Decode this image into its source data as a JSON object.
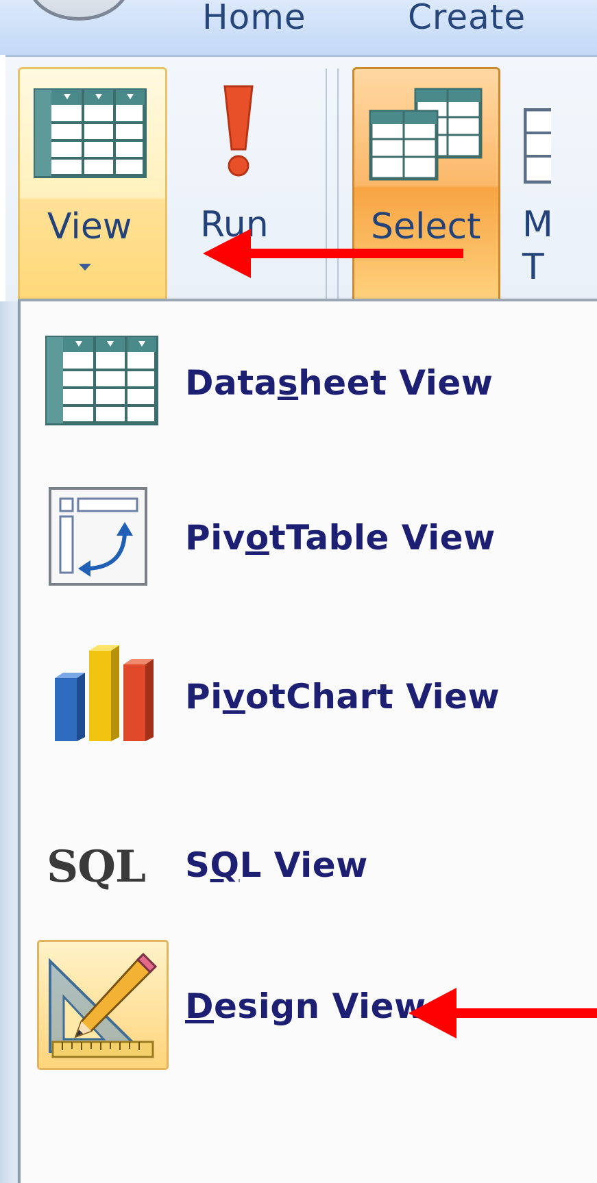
{
  "tabs": [
    {
      "label": "Home"
    },
    {
      "label": "Create"
    }
  ],
  "ribbon": {
    "view_button": {
      "label": "View",
      "icon": "datasheet-icon"
    },
    "run_button": {
      "label": "Run",
      "icon": "exclamation-icon"
    },
    "select_button": {
      "label": "Select",
      "icon": "select-query-icon"
    },
    "partial_button": {
      "label_line1": "M",
      "label_line2": "T"
    }
  },
  "menu": {
    "items": [
      {
        "pre": "Data",
        "key": "s",
        "post": "heet View",
        "icon": "datasheet-icon"
      },
      {
        "pre": "Piv",
        "key": "o",
        "post": "tTable View",
        "icon": "pivottable-icon"
      },
      {
        "pre": "Pi",
        "key": "v",
        "post": "otChart View",
        "icon": "pivotchart-icon"
      },
      {
        "pre": "S",
        "key": "Q",
        "post": "L View",
        "icon": "sql-icon",
        "icon_text": "SQL"
      },
      {
        "pre": "",
        "key": "D",
        "post": "esign View",
        "icon": "design-view-icon"
      }
    ]
  },
  "annotations": {
    "arrow_color": "#ff0000"
  },
  "colors": {
    "menu_text": "#1d1f73",
    "tab_text": "#26457a",
    "view_highlight": "#ffe197",
    "select_highlight": "#f7a443"
  }
}
